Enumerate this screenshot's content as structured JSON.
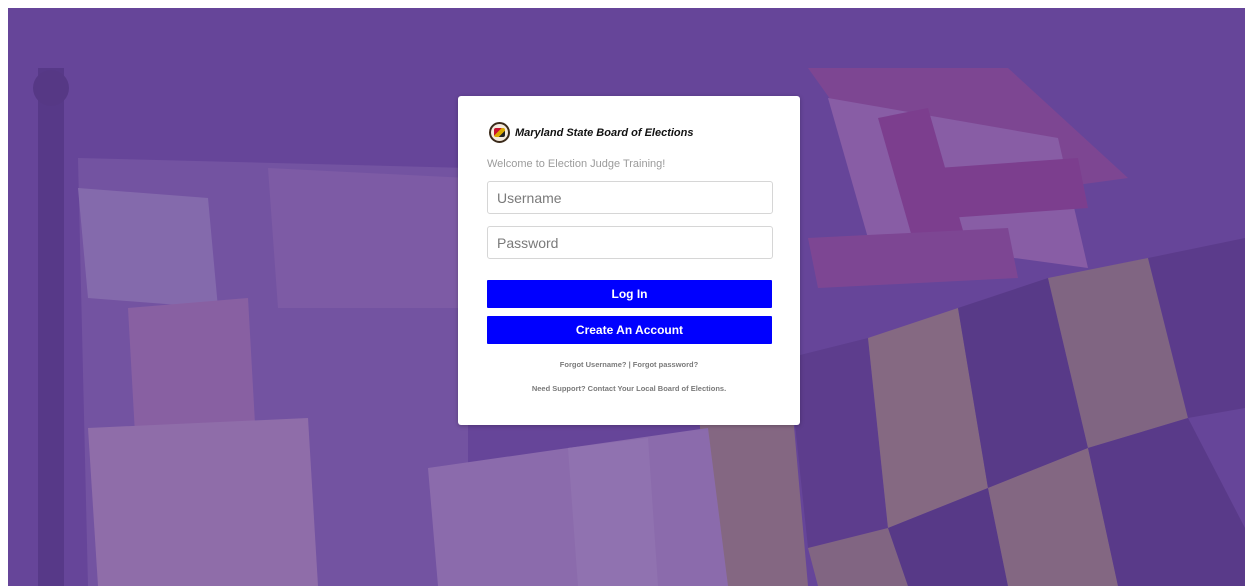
{
  "brand": {
    "name": "Maryland State Board of Elections"
  },
  "welcome": "Welcome to Election Judge Training!",
  "form": {
    "username_placeholder": "Username",
    "password_placeholder": "Password",
    "login_label": "Log In",
    "create_label": "Create An Account"
  },
  "links": {
    "forgot_username": "Forgot Username?",
    "separator": "|",
    "forgot_password": "Forgot password?",
    "support": "Need Support? Contact Your Local Board of Elections."
  },
  "colors": {
    "button": "#0000ff",
    "background_tint": "#6a4a9a"
  }
}
